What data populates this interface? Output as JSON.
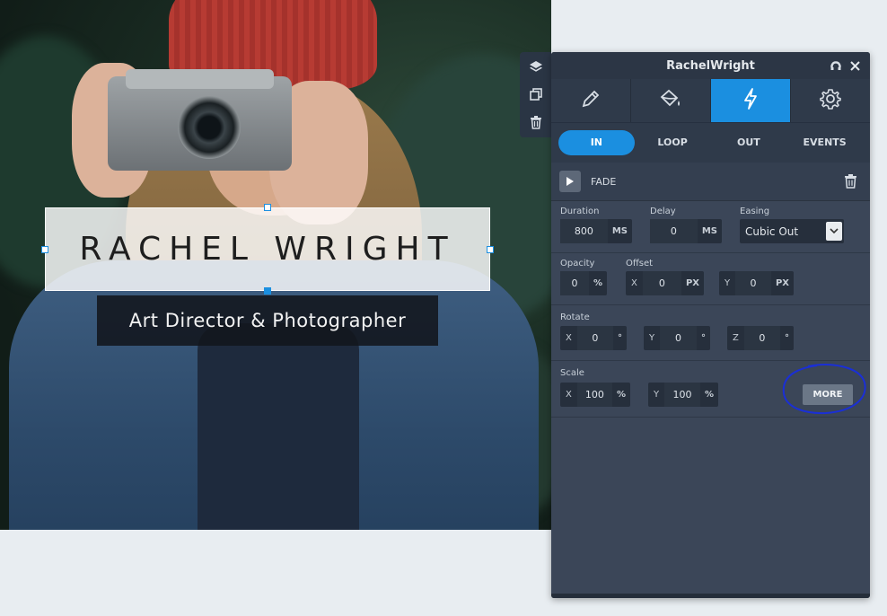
{
  "canvas": {
    "title_text": "RACHEL WRIGHT",
    "subtitle_text": "Art Director & Photographer"
  },
  "side_tools": [
    "layers-icon",
    "duplicate-icon",
    "trash-icon"
  ],
  "panel": {
    "title": "RachelWright",
    "main_tabs": [
      "pencil-icon",
      "paint-bucket-icon",
      "lightning-icon",
      "gear-icon"
    ],
    "active_main_tab": 2,
    "sub_tabs": [
      "IN",
      "LOOP",
      "OUT",
      "EVENTS"
    ],
    "active_sub_tab": 0,
    "animation": {
      "name": "FADE"
    },
    "timing": {
      "duration_label": "Duration",
      "duration_value": "800",
      "duration_unit": "MS",
      "delay_label": "Delay",
      "delay_value": "0",
      "delay_unit": "MS",
      "easing_label": "Easing",
      "easing_value": "Cubic Out"
    },
    "opacity": {
      "label": "Opacity",
      "value": "0",
      "unit": "%"
    },
    "offset": {
      "label": "Offset",
      "x_label": "X",
      "x_value": "0",
      "x_unit": "PX",
      "y_label": "Y",
      "y_value": "0",
      "y_unit": "PX"
    },
    "rotate": {
      "label": "Rotate",
      "x_label": "X",
      "x_value": "0",
      "y_label": "Y",
      "y_value": "0",
      "z_label": "Z",
      "z_value": "0",
      "unit": "°"
    },
    "scale": {
      "label": "Scale",
      "x_label": "X",
      "x_value": "100",
      "y_label": "Y",
      "y_value": "100",
      "unit": "%"
    },
    "more_label": "MORE"
  },
  "colors": {
    "accent": "#1b8fe0",
    "panel_bg": "#3b4658",
    "annotation": "#1a2fd6"
  }
}
